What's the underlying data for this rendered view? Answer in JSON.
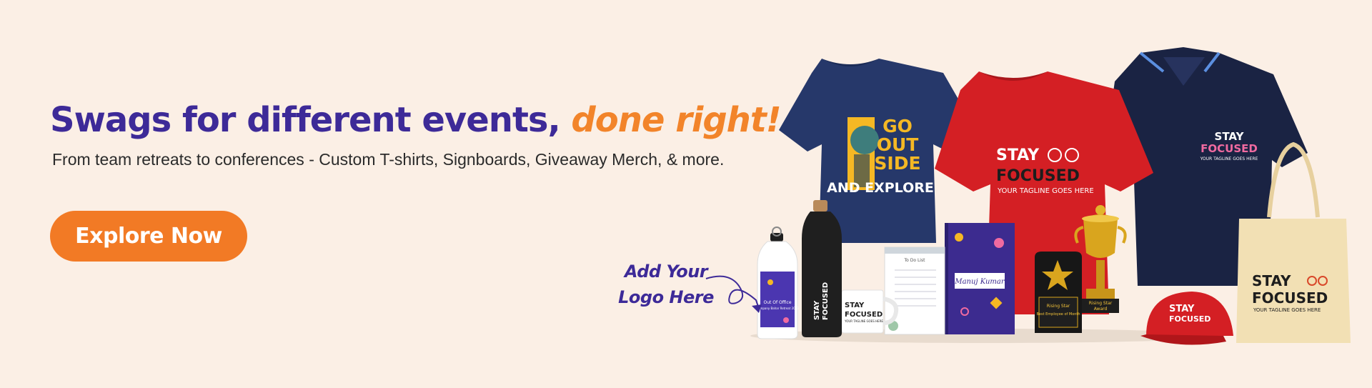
{
  "hero": {
    "headline_part1": "Swags for different events,",
    "headline_part2": "done right!",
    "subheadline": "From team retreats to conferences - Custom T-shirts, Signboards, Giveaway Merch, & more.",
    "cta_label": "Explore Now",
    "callout_line1": "Add Your",
    "callout_line2": "Logo Here"
  },
  "products": {
    "blue_tee_text": [
      "GO",
      "OUT",
      "SIDE",
      "AND EXPLORE"
    ],
    "red_tee_text": [
      "STAY",
      "FOCUSED",
      "YOUR TAGLINE GOES HERE"
    ],
    "polo_text": [
      "STAY",
      "FOCUSED",
      "YOUR TAGLINE GOES HERE"
    ],
    "tote_text": [
      "STAY",
      "FOCUSED",
      "YOUR TAGLINE GOES HERE"
    ],
    "cap_text": [
      "STAY",
      "FOCUSED"
    ],
    "mug_text": [
      "STAY",
      "FOCUSED",
      "YOUR TAGLINE GOES HERE"
    ],
    "black_bottle_text": [
      "STAY",
      "FOCUSED"
    ],
    "white_bottle_text": [
      "Out Of Office",
      "Company Bahar Retreat 2023"
    ],
    "notebook_text": "Manuj Kumar",
    "notepad_text": "To Do List",
    "plaque_text": [
      "Rising Star",
      "Best Employee of Month"
    ],
    "trophy_text": [
      "Rising Star",
      "Award"
    ]
  },
  "colors": {
    "background": "#fbefe5",
    "brand_purple": "#3d2a98",
    "brand_orange": "#f2842a",
    "cta_orange": "#f27a25"
  }
}
